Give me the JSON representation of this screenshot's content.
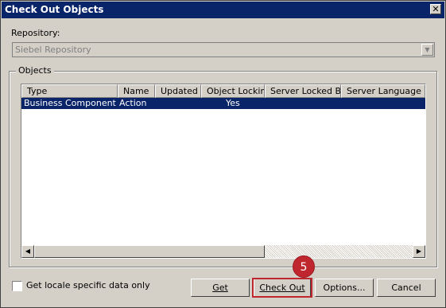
{
  "window": {
    "title": "Check Out Objects",
    "close_glyph": "✕"
  },
  "repository": {
    "label": "Repository:",
    "value": "Siebel Repository",
    "arrow_glyph": "▼"
  },
  "objects_group": {
    "title": "Objects"
  },
  "list": {
    "columns": [
      "Type",
      "Name",
      "Updated",
      "Object Locking",
      "Server Locked By",
      "Server Language"
    ],
    "rows": [
      {
        "type": "Business Component",
        "name": "Action",
        "updated": "",
        "object_locking": "Yes",
        "server_locked_by": "",
        "server_language": ""
      }
    ],
    "scroll_left_glyph": "◀",
    "scroll_right_glyph": "▶"
  },
  "locale_checkbox": {
    "label": "Get locale specific data only",
    "checked": false
  },
  "buttons": {
    "get": "Get",
    "check_out": "Check Out",
    "options": "Options...",
    "cancel": "Cancel"
  },
  "callout": {
    "step": "5",
    "color": "#c0262d"
  }
}
